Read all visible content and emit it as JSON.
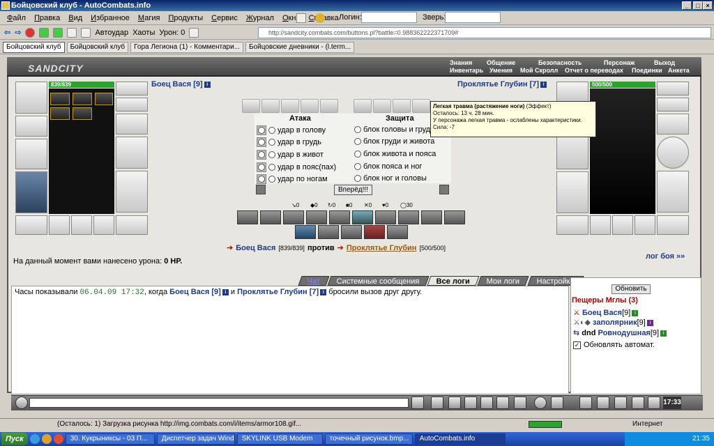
{
  "window": {
    "title": "Бойцовский клуб - AutoCombats.info"
  },
  "menu": [
    "Файл",
    "Правка",
    "Вид",
    "Избранное",
    "Магия",
    "Продукты",
    "Сервис",
    "Журнал",
    "Окна",
    "Справка"
  ],
  "top_fields": {
    "login_label": "Логин:",
    "beast_label": "Зверь:"
  },
  "toolbar": {
    "autohit_label": "Автоудар",
    "chaos_label": "Хаоты",
    "damage_label": "Урон: 0"
  },
  "address": "http://sandcity.combats.com/buttons.pl?battle=0.988362222371709#",
  "tabs": [
    "Бойцовский клуб",
    "Бойцовский клуб",
    "Гора Легиона (1) - Комментари...",
    "Бойцовские дневники - (l.term..."
  ],
  "game": {
    "logo": "SANDCITY",
    "nav_top": [
      "Знания",
      "Общение",
      "Безопасность",
      "Персонаж",
      "Выход"
    ],
    "nav_bottom": [
      "Инвентарь",
      "Умения",
      "Мой Скролл",
      "Отчет о переводах",
      "Поединки",
      "Анкета"
    ],
    "player": {
      "name": "Боец Вася [9]",
      "hp": "839/839"
    },
    "enemy": {
      "name": "Проклятье Глубин [7]",
      "hp": "500/500"
    },
    "attack_title": "Атака",
    "defense_title": "Защита",
    "attacks": [
      "удар в голову",
      "удар в грудь",
      "удар в живот",
      "удар в пояс(пах)",
      "удар по ногам"
    ],
    "defenses": [
      "блок головы и груди",
      "блок груди и живота",
      "блок живота и пояса",
      "блок пояса и ног",
      "блок ног и головы"
    ],
    "forward": "Вперёд!!!",
    "stats": [
      "0",
      "0",
      "0",
      "0",
      "0",
      "0",
      "30"
    ],
    "vs": {
      "p1": "Боец Вася",
      "p1hp": "[839/839]",
      "word": "против",
      "p2": "Проклятье Глубин",
      "p2hp": "[500/500]"
    },
    "damage": {
      "text": "На данный момент вами нанесено урона:",
      "value": "0 HP."
    },
    "fight_log": "лог боя »»",
    "tooltip": {
      "title": "Легкая травма (растяжение ноги)",
      "type": "(Эффект)",
      "line1": "Осталось: 13 ч. 28 мин.",
      "line2": "У персонажа легкая травма - ослаблены характеристики.",
      "line3": "Сила: -7"
    }
  },
  "chat": {
    "tabs": [
      "Чат",
      "Системные сообщения",
      "Все логи",
      "Мои логи",
      "Настройки"
    ],
    "msg_prefix": "Часы показывали",
    "date": "06.04.09 17:32",
    "msg_mid": ", когда",
    "p1": "Боец Вася [9]",
    "and": "и",
    "p2": "Проклятье Глубин [7]",
    "msg_end": "бросили вызов друг другу."
  },
  "side": {
    "refresh": "Обновить",
    "location": "Пещеры Мглы (3)",
    "players": [
      {
        "name": "Боец Вася",
        "level": "[9]"
      },
      {
        "name": "заполярник",
        "level": "[9]"
      },
      {
        "name": "Ровнодушная",
        "level": "[9]",
        "prefix": "dnd"
      }
    ],
    "auto_refresh": "Обновлять автомат."
  },
  "clock": "17:33",
  "status": {
    "text": "(Осталось: 1) Загрузка рисунка http://img.combats.com/i/items/armor108.gif...",
    "zone": "Интернет"
  },
  "taskbar": {
    "start": "Пуск",
    "items": [
      "30. Кукрыниксы - 03 П...",
      "Диспетчер задач Wind...",
      "SKYLINK USB Modem",
      "точечный рисунок.bmp...",
      "AutoCombats.info"
    ],
    "time": "21:35"
  }
}
